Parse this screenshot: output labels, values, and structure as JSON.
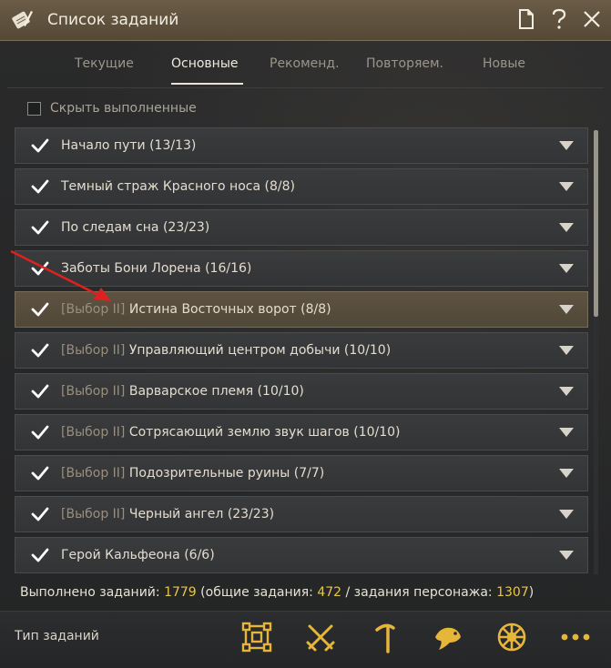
{
  "window": {
    "title": "Список заданий"
  },
  "title_icons": [
    "document-icon",
    "help-icon",
    "close-icon"
  ],
  "tabs": [
    {
      "label": "Текущие",
      "active": false
    },
    {
      "label": "Основные",
      "active": true
    },
    {
      "label": "Рекоменд.",
      "active": false
    },
    {
      "label": "Повторяем.",
      "active": false
    },
    {
      "label": "Новые",
      "active": false
    }
  ],
  "filter": {
    "hide_completed_label": "Скрыть выполненные",
    "checked": false
  },
  "quests": [
    {
      "prefix": "",
      "name": "Начало пути",
      "count": "(13/13)",
      "completed": true,
      "selected": false
    },
    {
      "prefix": "",
      "name": "Темный страж Красного носа",
      "count": "(8/8)",
      "completed": true,
      "selected": false
    },
    {
      "prefix": "",
      "name": "По следам сна",
      "count": "(23/23)",
      "completed": true,
      "selected": false
    },
    {
      "prefix": "",
      "name": "Заботы Бони Лорена",
      "count": "(16/16)",
      "completed": true,
      "selected": false
    },
    {
      "prefix": "[Выбор II]",
      "name": "Истина Восточных ворот",
      "count": "(8/8)",
      "completed": true,
      "selected": true
    },
    {
      "prefix": "[Выбор II]",
      "name": "Управляющий центром добычи",
      "count": "(10/10)",
      "completed": true,
      "selected": false
    },
    {
      "prefix": "[Выбор II]",
      "name": "Варварское племя",
      "count": "(10/10)",
      "completed": true,
      "selected": false
    },
    {
      "prefix": "[Выбор II]",
      "name": "Сотрясающий землю звук шагов",
      "count": "(10/10)",
      "completed": true,
      "selected": false
    },
    {
      "prefix": "[Выбор II]",
      "name": "Подозрительные руины",
      "count": "(7/7)",
      "completed": true,
      "selected": false
    },
    {
      "prefix": "[Выбор II]",
      "name": "Черный ангел",
      "count": "(23/23)",
      "completed": true,
      "selected": false
    },
    {
      "prefix": "",
      "name": "Герой Кальфеона",
      "count": "(6/6)",
      "completed": true,
      "selected": false
    }
  ],
  "summary": {
    "label_completed": "Выполнено заданий:",
    "total": "1779",
    "label_common": "(общие задания:",
    "common": "472",
    "label_character": "/ задания персонажа:",
    "character": "1307",
    "close_paren": ")"
  },
  "footer": {
    "label": "Тип заданий",
    "icons": [
      "quest-type-all-icon",
      "combat-icon",
      "gathering-icon",
      "fishing-icon",
      "trade-icon",
      "more-icon"
    ]
  },
  "colors": {
    "accent_gold": "#e8c64a",
    "selected_row": "#5e5343",
    "title_bar": "#6a5c46",
    "annotation_red": "#e02020"
  },
  "annotation": {
    "type": "red-arrow",
    "points_to": "[Выбор II] Истина Восточных ворот"
  }
}
